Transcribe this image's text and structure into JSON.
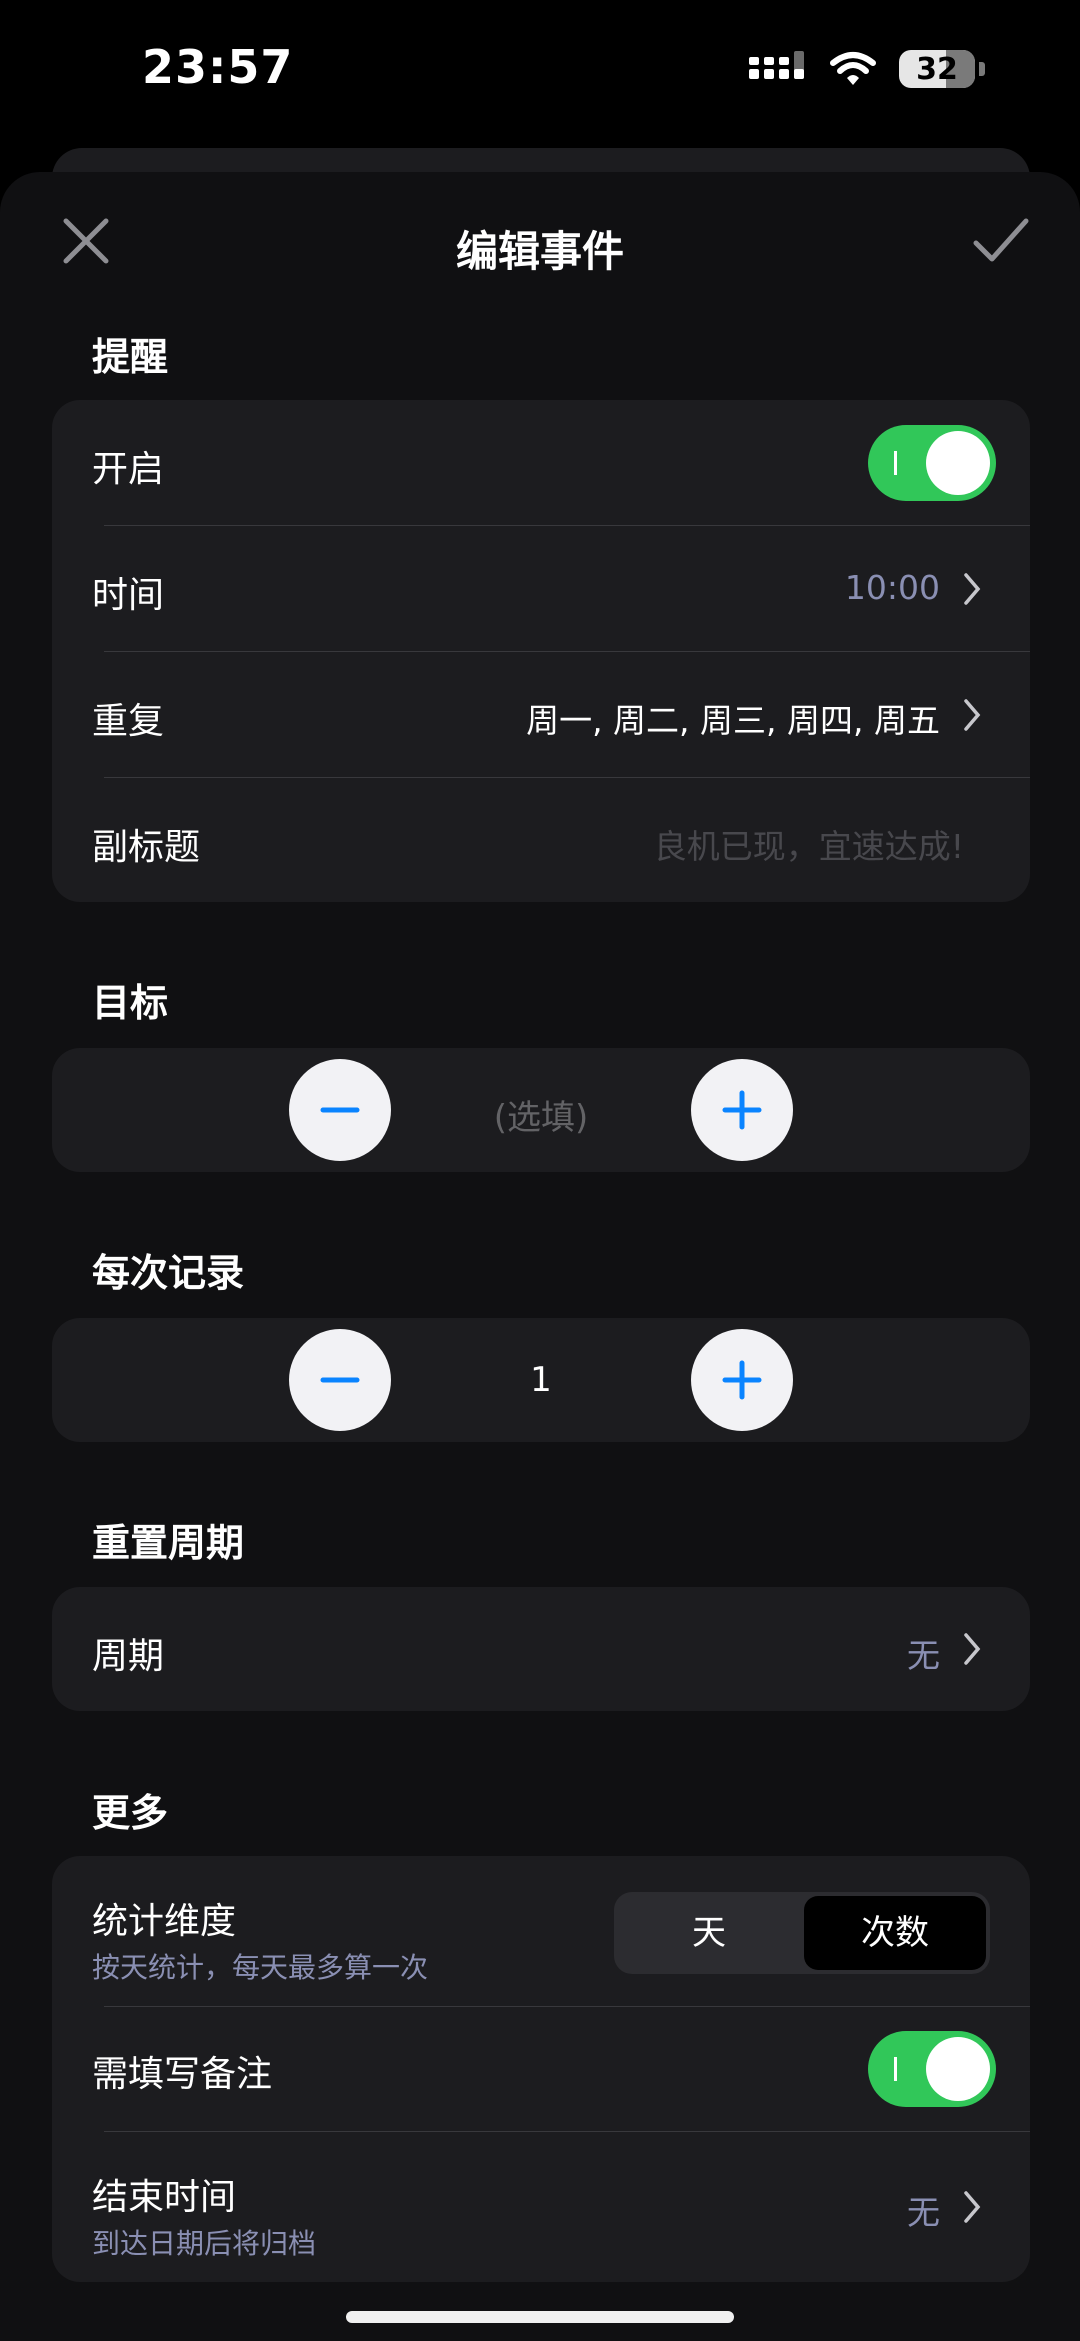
{
  "status_bar": {
    "time": "23:57",
    "battery": "32"
  },
  "nav": {
    "title": "编辑事件"
  },
  "reminder": {
    "header": "提醒",
    "enable_label": "开启",
    "enabled": true,
    "time_label": "时间",
    "time_value": "10:00",
    "repeat_label": "重复",
    "repeat_value": "周一, 周二, 周三, 周四, 周五",
    "subtitle_label": "副标题",
    "subtitle_placeholder": "良机已现，宜速达成!"
  },
  "goal": {
    "header": "目标",
    "value": "(选填)"
  },
  "per_record": {
    "header": "每次记录",
    "value": "1"
  },
  "reset": {
    "header": "重置周期",
    "period_label": "周期",
    "period_value": "无"
  },
  "more": {
    "header": "更多",
    "stat_label": "统计维度",
    "stat_sub": "按天统计，每天最多算一次",
    "stat_options": [
      "天",
      "次数"
    ],
    "stat_selected": "次数",
    "note_label": "需填写备注",
    "note_enabled": true,
    "end_label": "结束时间",
    "end_sub": "到达日期后将归档",
    "end_value": "无"
  },
  "colors": {
    "accent_green": "#31c759",
    "accent_blue": "#0a84ff",
    "muted_value": "#8a8fb3"
  }
}
